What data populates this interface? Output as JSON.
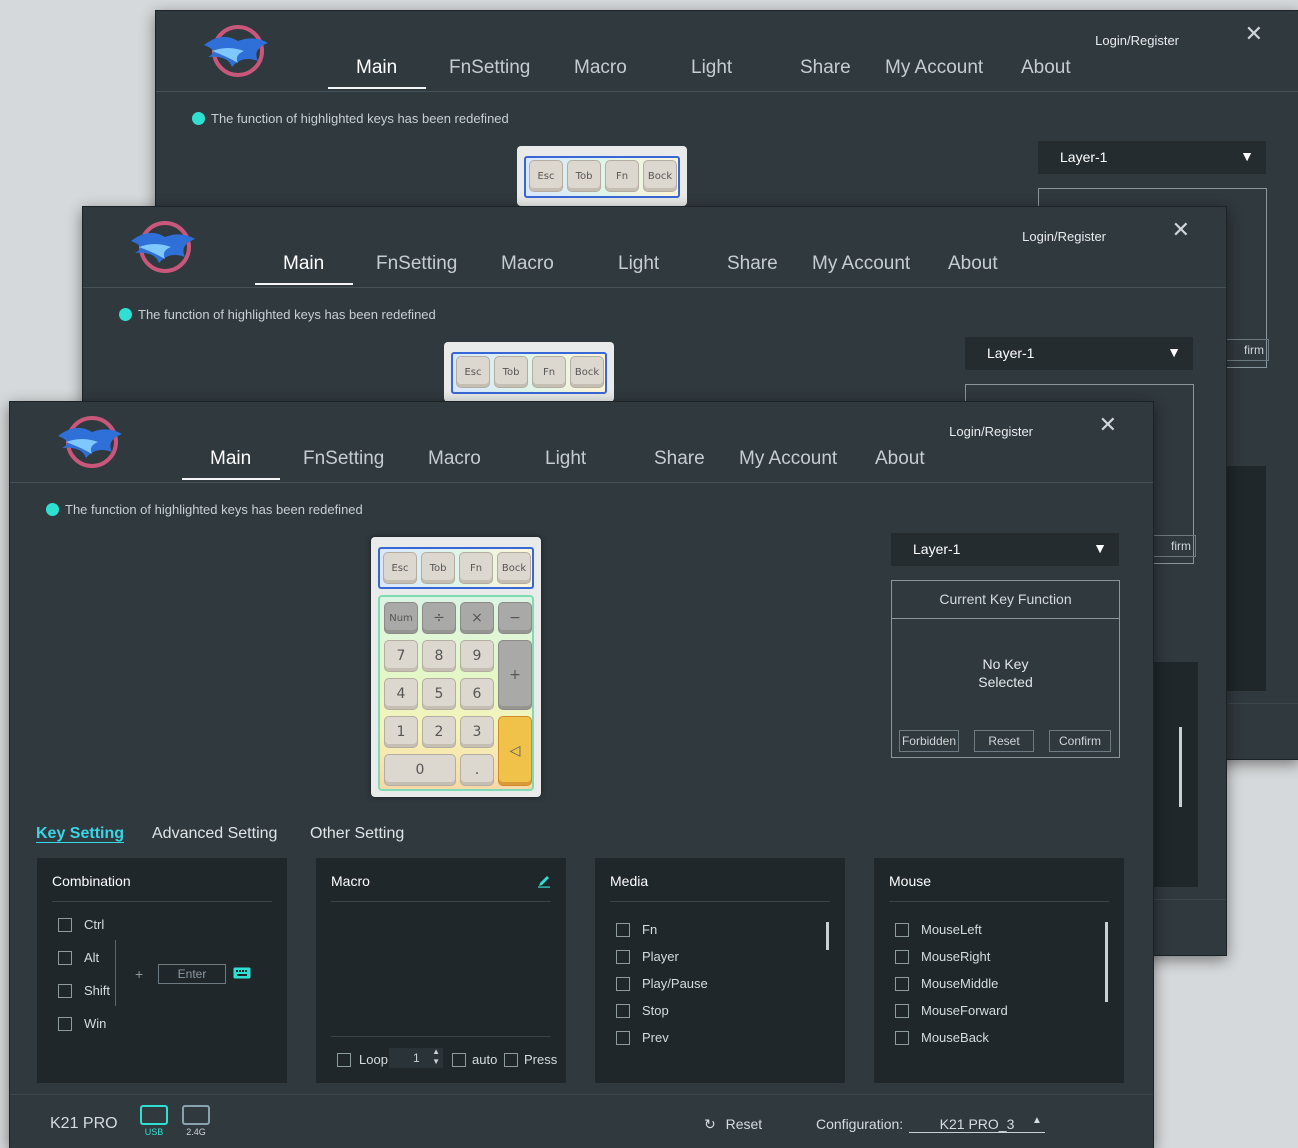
{
  "app": {
    "login_label": "Login/Register",
    "close_icon": "close-icon",
    "logo_icon": "dragon-flame-logo"
  },
  "nav": {
    "tabs": [
      "Main",
      "FnSetting",
      "Macro",
      "Light",
      "Share",
      "My Account",
      "About"
    ],
    "active": "Main"
  },
  "notice": "The function of highlighted keys has been redefined",
  "keypad": {
    "top_row": [
      "Esc",
      "Tob",
      "Fn",
      "Bock"
    ],
    "rows": [
      [
        "Num",
        "÷",
        "×",
        "−"
      ],
      [
        "7",
        "8",
        "9",
        "+"
      ],
      [
        "4",
        "5",
        "6"
      ],
      [
        "1",
        "2",
        "3",
        "◁"
      ],
      [
        "0",
        "."
      ]
    ]
  },
  "layer": {
    "value": "Layer-1",
    "arrow": "▼"
  },
  "current_key": {
    "title": "Current Key Function",
    "status_line1": "No Key",
    "status_line2": "Selected",
    "buttons": {
      "forbidden": "Forbidden",
      "reset": "Reset",
      "confirm": "Confirm"
    }
  },
  "ghost": {
    "confirm_partial": "firm"
  },
  "subtabs": [
    "Key Setting",
    "Advanced Setting",
    "Other Setting"
  ],
  "panels": {
    "combination": {
      "title": "Combination",
      "modifiers": [
        "Ctrl",
        "Alt",
        "Shift",
        "Win"
      ],
      "plus": "+",
      "key_placeholder": "Enter",
      "keyboard_icon": "keyboard-icon"
    },
    "macro": {
      "title": "Macro",
      "edit_icon": "pencil-icon",
      "loop_label": "Loop",
      "loop_value": "1",
      "auto_label": "auto",
      "press_label": "Press"
    },
    "media": {
      "title": "Media",
      "items": [
        "Fn",
        "Player",
        "Play/Pause",
        "Stop",
        "Prev"
      ]
    },
    "mouse": {
      "title": "Mouse",
      "items": [
        "MouseLeft",
        "MouseRight",
        "MouseMiddle",
        "MouseForward",
        "MouseBack"
      ]
    }
  },
  "footer": {
    "model": "K21 PRO",
    "usb_label": "USB",
    "wireless_label": "2.4G",
    "reset_label": "Reset",
    "reset_icon": "refresh-icon",
    "config_label": "Configuration:",
    "config_value": "K21 PRO_3",
    "config_arrow": "▲"
  },
  "colors": {
    "background": "#30393e",
    "panel": "#1f272b",
    "accent": "#2fe0d2",
    "subtab_active": "#38d6e6"
  }
}
